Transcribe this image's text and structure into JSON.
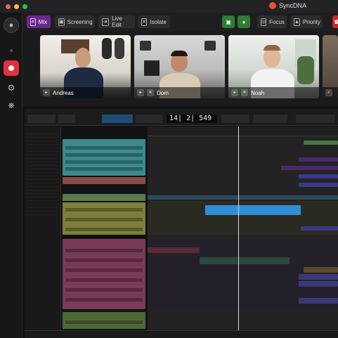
{
  "window": {
    "title": "SyncDNA"
  },
  "toolbar": {
    "mix": "Mix",
    "screening": "Screening",
    "live_edit": "Live Edit",
    "isolate": "Isolate",
    "focus": "Focus",
    "priority": "Priority"
  },
  "participants": [
    {
      "name": "Andreas"
    },
    {
      "name": "Dom"
    },
    {
      "name": "Noah"
    }
  ],
  "daw": {
    "counter": "14| 2| 549"
  },
  "colors": {
    "accent": "#6a2a8a",
    "record": "#e0323a",
    "camera_on": "#2e7d32",
    "selected_clip": "#2f8ed8"
  },
  "icons": {
    "user": "user-icon",
    "record": "record-icon",
    "settings": "gear-icon",
    "debug": "bug-icon"
  }
}
